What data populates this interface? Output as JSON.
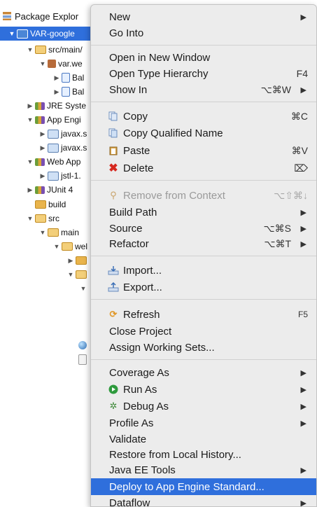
{
  "explorer": {
    "tab_label": "Package Explor",
    "rows": [
      {
        "label": "VAR-google",
        "icon": "project-icon"
      },
      {
        "label": "src/main/",
        "icon": "source-folder-icon"
      },
      {
        "label": "var.we",
        "icon": "package-icon"
      },
      {
        "label": "Bal",
        "icon": "java-file-icon"
      },
      {
        "label": "Bal",
        "icon": "java-file-icon"
      },
      {
        "label": "JRE Syste",
        "icon": "library-icon"
      },
      {
        "label": "App Engi",
        "icon": "library-icon"
      },
      {
        "label": "javax.s",
        "icon": "jar-icon"
      },
      {
        "label": "javax.s",
        "icon": "jar-icon"
      },
      {
        "label": "Web App",
        "icon": "library-icon"
      },
      {
        "label": "jstl-1.",
        "icon": "jar-icon"
      },
      {
        "label": "JUnit 4",
        "icon": "library-icon"
      },
      {
        "label": "build",
        "icon": "folder-icon"
      },
      {
        "label": "src",
        "icon": "folder-icon"
      },
      {
        "label": "main",
        "icon": "folder-icon"
      },
      {
        "label": "wel",
        "icon": "folder-icon"
      }
    ]
  },
  "menu": {
    "new": "New",
    "go_into": "Go Into",
    "open_new_window": "Open in New Window",
    "open_type_hierarchy": "Open Type Hierarchy",
    "open_type_hierarchy_sc": "F4",
    "show_in": "Show In",
    "show_in_sc": "⌥⌘W",
    "copy": "Copy",
    "copy_sc": "⌘C",
    "copy_qualified": "Copy Qualified Name",
    "paste": "Paste",
    "paste_sc": "⌘V",
    "delete": "Delete",
    "delete_sc": "⌦",
    "remove_context": "Remove from Context",
    "remove_context_sc": "⌥⇧⌘↓",
    "build_path": "Build Path",
    "source": "Source",
    "source_sc": "⌥⌘S",
    "refactor": "Refactor",
    "refactor_sc": "⌥⌘T",
    "import": "Import...",
    "export": "Export...",
    "refresh": "Refresh",
    "refresh_sc": "F5",
    "close_project": "Close Project",
    "assign_working_sets": "Assign Working Sets...",
    "coverage_as": "Coverage As",
    "run_as": "Run As",
    "debug_as": "Debug As",
    "profile_as": "Profile As",
    "validate": "Validate",
    "restore_history": "Restore from Local History...",
    "java_ee_tools": "Java EE Tools",
    "deploy": "Deploy to App Engine Standard...",
    "dataflow": "Dataflow"
  },
  "colors": {
    "highlight": "#2f6fdc",
    "menu_bg": "#ececec"
  }
}
